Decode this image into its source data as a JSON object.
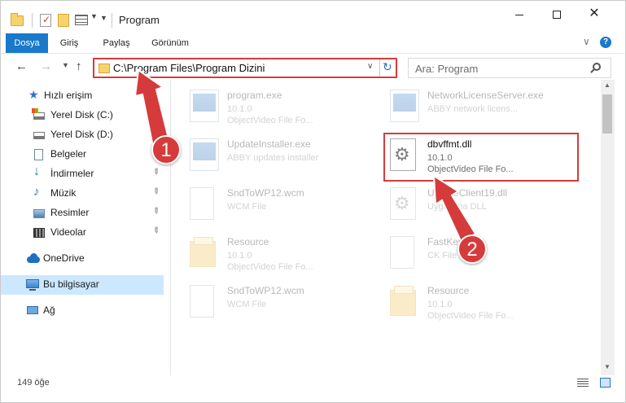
{
  "window": {
    "title": "Program",
    "minimize_glyph": "",
    "close_glyph": "✕"
  },
  "ribbon": {
    "tabs": [
      "Dosya",
      "Giriş",
      "Paylaş",
      "Görünüm"
    ],
    "help_glyph": "?"
  },
  "nav": {
    "address": "C:\\Program Files\\Program Dizini",
    "search_placeholder": "Ara: Program"
  },
  "sidebar": {
    "items": [
      {
        "label": "Hızlı erişim",
        "icon": "star-icon",
        "pinned": false
      },
      {
        "label": "Yerel Disk (C:)",
        "icon": "drive-c-icon",
        "pinned": false
      },
      {
        "label": "Yerel Disk (D:)",
        "icon": "drive-icon",
        "pinned": false
      },
      {
        "label": "Belgeler",
        "icon": "documents-icon",
        "pinned": false
      },
      {
        "label": "İndirmeler",
        "icon": "downloads-icon",
        "pinned": true
      },
      {
        "label": "Müzik",
        "icon": "music-icon",
        "pinned": true
      },
      {
        "label": "Resimler",
        "icon": "pictures-icon",
        "pinned": true
      },
      {
        "label": "Videolar",
        "icon": "videos-icon",
        "pinned": true
      },
      {
        "label": "OneDrive",
        "icon": "onedrive-icon",
        "pinned": false
      },
      {
        "label": "Bu bilgisayar",
        "icon": "this-pc-icon",
        "pinned": false,
        "selected": true
      },
      {
        "label": "Ağ",
        "icon": "network-icon",
        "pinned": false
      }
    ]
  },
  "files": [
    {
      "name": "program.exe",
      "line2": "10.1.0",
      "line3": "ObjectVideo File Fo...",
      "icon": "exe-icon",
      "faded": true
    },
    {
      "name": "NetworkLicenseServer.exe",
      "line2": "ABBY network licens...",
      "line3": "",
      "icon": "exe-icon",
      "faded": true
    },
    {
      "name": "UpdateInstaller.exe",
      "line2": "ABBY updates installer",
      "line3": "",
      "icon": "exe-icon",
      "faded": true
    },
    {
      "name": "dbvffmt.dll",
      "line2": "10.1.0",
      "line3": "ObjectVideo File Fo...",
      "icon": "dll-gear-icon",
      "faded": false,
      "highlighted": true
    },
    {
      "name": "SndToWP12.wcm",
      "line2": "WCM File",
      "line3": "",
      "icon": "file-page-icon",
      "faded": true
    },
    {
      "name": "UpdateClient19.dll",
      "line2": "Uygulama DLL",
      "line3": "",
      "icon": "dll-gear-icon",
      "faded": true
    },
    {
      "name": "Resource",
      "line2": "10.1.0",
      "line3": "ObjectVideo File Fo...",
      "icon": "folder-icon",
      "faded": true
    },
    {
      "name": "FastKey",
      "line2": "CK File",
      "line3": "",
      "icon": "file-page-icon",
      "faded": true
    },
    {
      "name": "SndToWP12.wcm",
      "line2": "WCM File",
      "line3": "",
      "icon": "file-page-icon",
      "faded": true
    },
    {
      "name": "Resource",
      "line2": "10.1.0",
      "line3": "ObjectVideo File Fo...",
      "icon": "folder-icon",
      "faded": true
    }
  ],
  "status": {
    "item_count": "149 öğe"
  },
  "annotations": {
    "badge1": "1",
    "badge2": "2",
    "color": "#d63b3b"
  }
}
